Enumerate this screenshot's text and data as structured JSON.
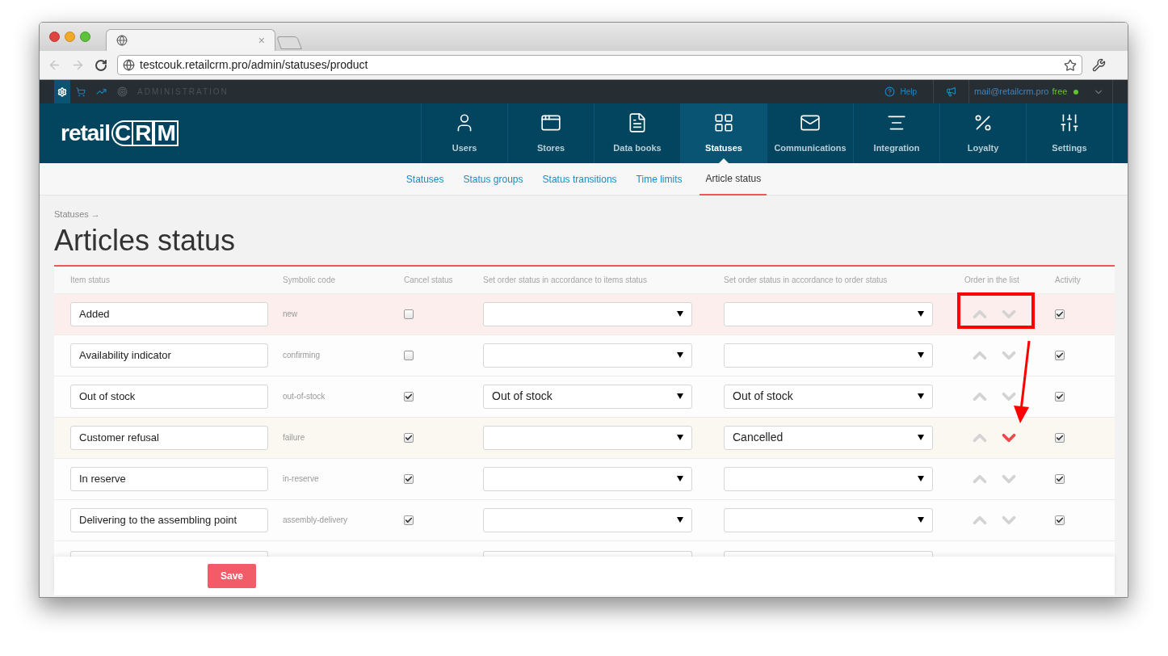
{
  "browser": {
    "tab_close": "×",
    "url": "testcouk.retailcrm.pro/admin/statuses/product"
  },
  "admin_bar": {
    "section": "ADMINISTRATION",
    "help": "Help",
    "email": "mail@retailcrm.pro",
    "plan": "free",
    "online": true
  },
  "logo": {
    "word": "retail",
    "mark": "CRM"
  },
  "nav": [
    {
      "label": "Users",
      "selected": false
    },
    {
      "label": "Stores",
      "selected": false
    },
    {
      "label": "Data books",
      "selected": false
    },
    {
      "label": "Statuses",
      "selected": true
    },
    {
      "label": "Communications",
      "selected": false
    },
    {
      "label": "Integration",
      "selected": false
    },
    {
      "label": "Loyalty",
      "selected": false
    },
    {
      "label": "Settings",
      "selected": false
    }
  ],
  "subnav": [
    {
      "label": "Statuses",
      "selected": false
    },
    {
      "label": "Status groups",
      "selected": false
    },
    {
      "label": "Status transitions",
      "selected": false
    },
    {
      "label": "Time limits",
      "selected": false
    },
    {
      "label": "Article status",
      "selected": true
    }
  ],
  "breadcrumb": "Statuses →",
  "title": "Articles status",
  "columns": [
    "Item status",
    "Symbolic code",
    "Cancel status",
    "Set order status in accordance to items status",
    "Set order status in accordance to order status",
    "Order in the list",
    "Activity"
  ],
  "rows": [
    {
      "name": "Added",
      "code": "new",
      "cancel": false,
      "color": "#fdeeee",
      "down_marked": false,
      "active": true
    },
    {
      "name": "Availability indicator",
      "code": "confirming",
      "cancel": false,
      "color": "#fdfdfd",
      "down_marked": false,
      "active": true
    },
    {
      "name": "Out of stock",
      "code": "out-of-stock",
      "cancel": true,
      "items_status": "Out of stock",
      "order_status": "Out of stock",
      "color": "#fdfdfd",
      "down_marked": false,
      "active": true
    },
    {
      "name": "Customer refusal",
      "code": "failure",
      "cancel": true,
      "order_status": "Cancelled",
      "color": "#faf8f1",
      "down_marked": true,
      "active": true
    },
    {
      "name": "In reserve",
      "code": "in-reserve",
      "cancel": true,
      "color": "#fdfdfd",
      "down_marked": false,
      "active": true
    },
    {
      "name": "Delivering to the assembling point",
      "code": "assembly-delivery",
      "cancel": true,
      "color": "#fdfdfd",
      "down_marked": false,
      "active": true
    }
  ],
  "save": "Save"
}
